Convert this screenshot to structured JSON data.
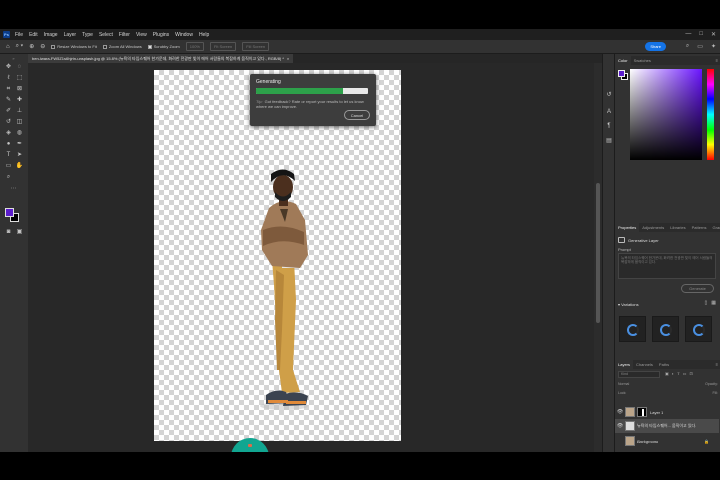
{
  "menubar": {
    "app_logo": "Ps",
    "items": [
      "File",
      "Edit",
      "Image",
      "Layer",
      "Type",
      "Select",
      "Filter",
      "View",
      "Plugins",
      "Window",
      "Help"
    ],
    "window_controls": [
      "—",
      "□",
      "✕"
    ]
  },
  "options_bar": {
    "resize_windows_label": "Resize Windows to Fit",
    "zoom_all_windows_label": "Zoom All Windows",
    "scrubby_zoom_label": "Scrubby Zoom",
    "zoom_percent": "100%",
    "fit_screen_label": "Fit Screen",
    "fill_screen_label": "Fill Screen",
    "share_label": "Share"
  },
  "document_tab": {
    "title": "ben-iwara-FW5Z1s6hjrtn-unsplash.jpg @ 15.8% (뉴욕의 타임스퀘어 한가운데, 화려한 전광판 빛이 에어 서람들의 복잡하게 움직이고 있다., RGB/8) *",
    "close": "×"
  },
  "generating_dialog": {
    "title": "Generating",
    "progress": 0.78,
    "progress_color": "#2da14a",
    "tip_label": "Tip:",
    "tip_text": "Got feedback? Rate or report your results to let us know where we can improve.",
    "cancel_label": "Cancel"
  },
  "colors": {
    "foreground": "#5b1ccc",
    "background": "#000000",
    "accent": "#1473e6",
    "fab": "#11a691"
  },
  "color_panel": {
    "tabs": [
      "Color",
      "Swatches"
    ]
  },
  "properties_panel": {
    "tabs": [
      "Properties",
      "Adjustments",
      "Libraries",
      "Patterns",
      "Gradient"
    ],
    "layer_type": "Generative Layer",
    "prompt_label": "Prompt",
    "prompt_text": "뉴욕의 타임스퀘어 한가운데, 화려한 전광판 빛이 에어 서람들의 복잡하게 움직이고 있다.",
    "generate_label": "Generate",
    "variations_label": "Variations"
  },
  "layers_panel": {
    "tabs": [
      "Layers",
      "Channels",
      "Paths"
    ],
    "search_placeholder": "Kind",
    "blend_mode": "Normal",
    "opacity_label": "Opacity:",
    "lock_label": "Lock:",
    "fill_label": "Fill:",
    "layers": [
      {
        "name": "Layer 1",
        "selected": false
      },
      {
        "name": "뉴욕의 타임스퀘어... 움직이고 있다.",
        "selected": true
      },
      {
        "name": "Background",
        "selected": false
      }
    ]
  }
}
